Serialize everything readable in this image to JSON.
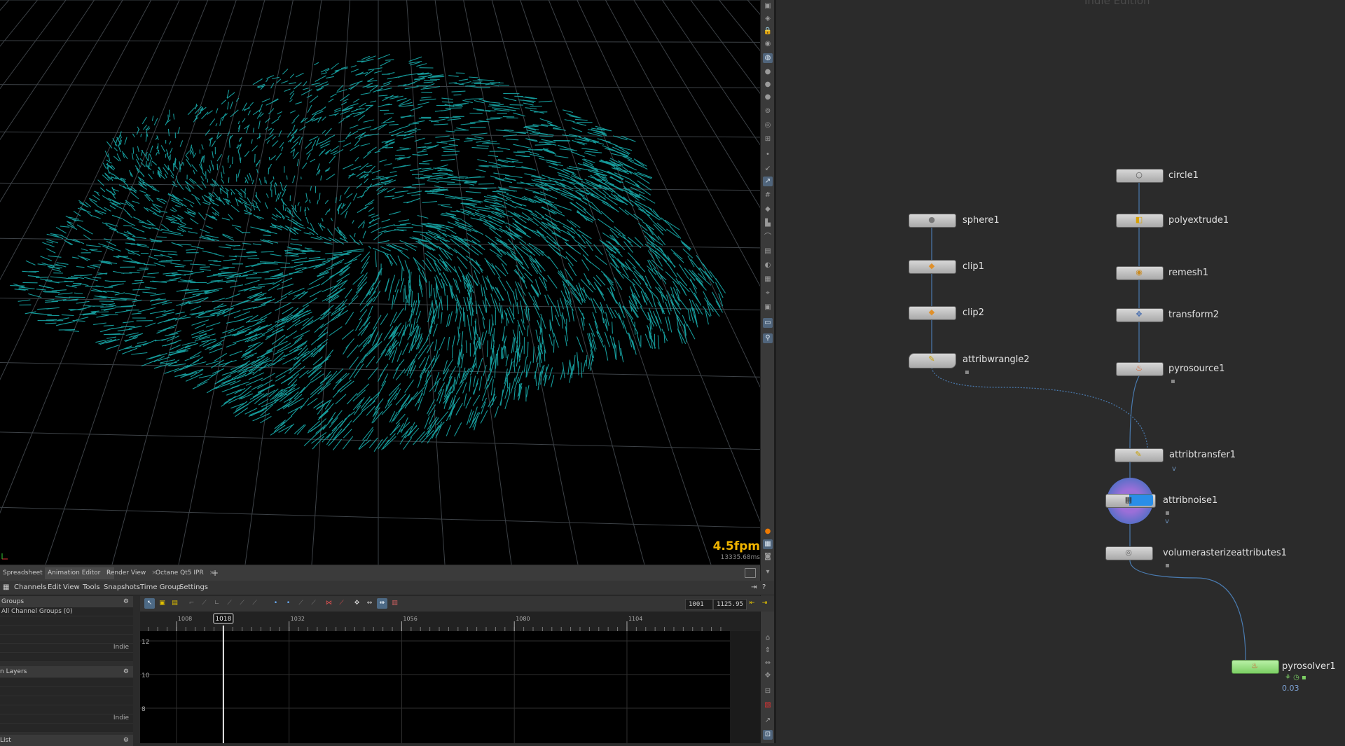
{
  "viewport": {
    "fps": "4.5fpm",
    "frame_ms": "13335.68ms"
  },
  "tabs": [
    {
      "label": "Spreadsheet"
    },
    {
      "label": "Animation Editor"
    },
    {
      "label": "Render View"
    },
    {
      "label": "Octane Qt5 IPR"
    },
    {
      "label": "+"
    }
  ],
  "menu": [
    "Channels",
    "Edit",
    "View",
    "Tools",
    "Snapshots",
    "Time Group",
    "Settings"
  ],
  "anim_editor": {
    "start_frame": "1001",
    "end_frame": "1125.95",
    "current_frame": "1018",
    "ruler_ticks": [
      "1008",
      "1032",
      "1056",
      "1080",
      "1104"
    ],
    "y_ticks": [
      "12",
      "10",
      "8"
    ]
  },
  "groups_panel": {
    "title": "Groups",
    "row1": "All Channel Groups (0)",
    "edition": "Indie"
  },
  "layers_panel": {
    "title": "n Layers",
    "edition": "Indie"
  },
  "list_panel": {
    "title": "List"
  },
  "network": {
    "watermark": "Indie Edition",
    "nodes": {
      "circle1": "circle1",
      "polyextrude1": "polyextrude1",
      "remesh1": "remesh1",
      "transform2": "transform2",
      "pyrosource1": "pyrosource1",
      "sphere1": "sphere1",
      "clip1": "clip1",
      "clip2": "clip2",
      "attribwrangle2": "attribwrangle2",
      "attribtransfer1": "attribtransfer1",
      "attribnoise1": "attribnoise1",
      "volumerasterizeattributes1": "volumerasterizeattributes1",
      "pyrosolver1": "pyrosolver1"
    },
    "pyrosolver_time": "0.03",
    "flag_v": "v"
  },
  "colors": {
    "strands": "#19b5b5",
    "fps": "#f0b400",
    "solver_node": "#9be08a",
    "wire": "#4a7bb0",
    "noise_ring": "#5b6fc8"
  }
}
